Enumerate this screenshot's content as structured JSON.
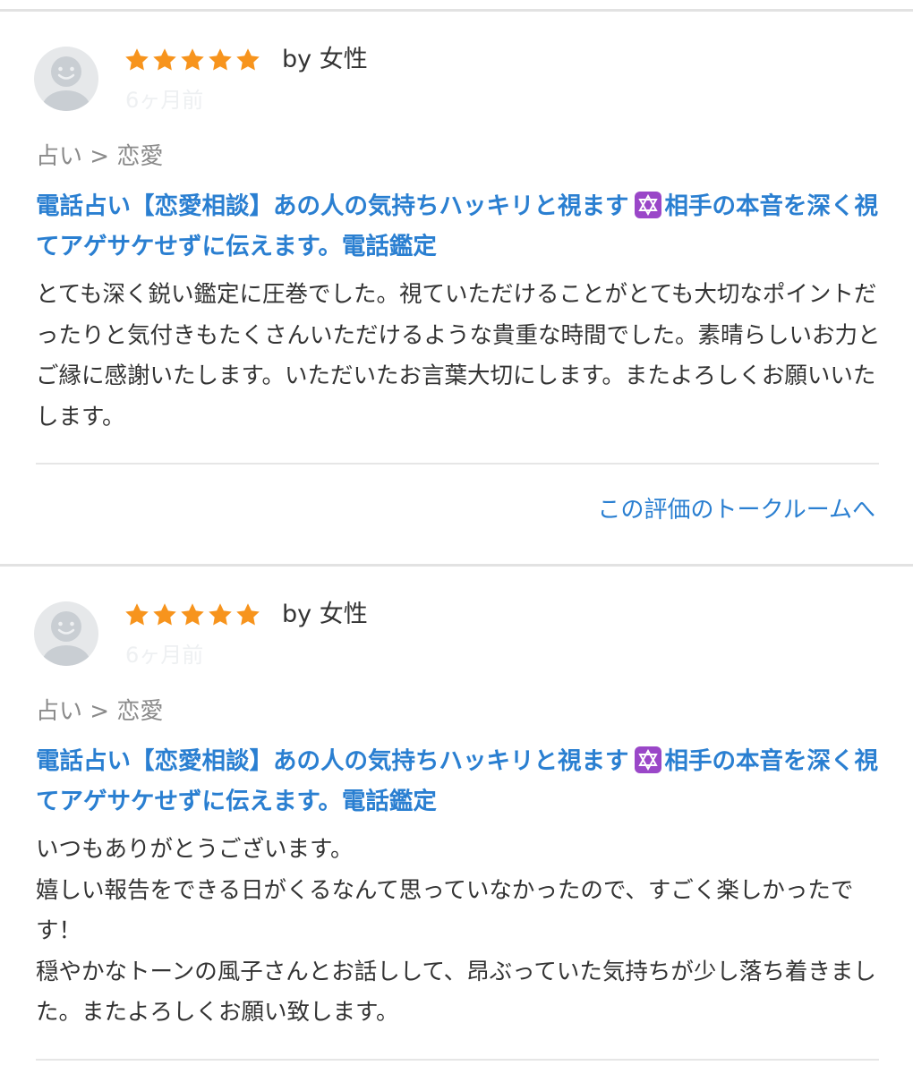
{
  "reviews": [
    {
      "rating": 5,
      "by": "by 女性",
      "time": "6ヶ月前",
      "category": "占い > 恋愛",
      "title_part1": "電話占い【恋愛相談】あの人の気持ちハッキリと視ます",
      "title_part2": "相手の本音を深く視てアゲサケせずに伝えます。電話鑑定",
      "body": "とても深く鋭い鑑定に圧巻でした。視ていただけることがとても大切なポイントだったりと気付きもたくさんいただけるような貴重な時間でした。素晴らしいお力とご縁に感謝いたします。いただいたお言葉大切にします。またよろしくお願いいたします。",
      "talk_link": "この評価のトークルームへ"
    },
    {
      "rating": 5,
      "by": "by 女性",
      "time": "6ヶ月前",
      "category": "占い > 恋愛",
      "title_part1": "電話占い【恋愛相談】あの人の気持ちハッキリと視ます",
      "title_part2": "相手の本音を深く視てアゲサケせずに伝えます。電話鑑定",
      "body": "いつもありがとうございます。\n嬉しい報告をできる日がくるなんて思っていなかったので、すごく楽しかったです！\n穏やかなトーンの風子さんとお話しして、昂ぶっていた気持ちが少し落ち着きました。またよろしくお願い致します。"
    }
  ],
  "colors": {
    "star": "#f7941d",
    "link": "#2a7fd1",
    "text": "#333333",
    "muted": "#8a8a8a",
    "divider": "#e2e2e2",
    "emoji_bg": "#9a47c8"
  },
  "icons": {
    "avatar": "default-user-avatar-icon",
    "star": "star-icon",
    "emoji": "star-of-david-emoji-icon"
  }
}
